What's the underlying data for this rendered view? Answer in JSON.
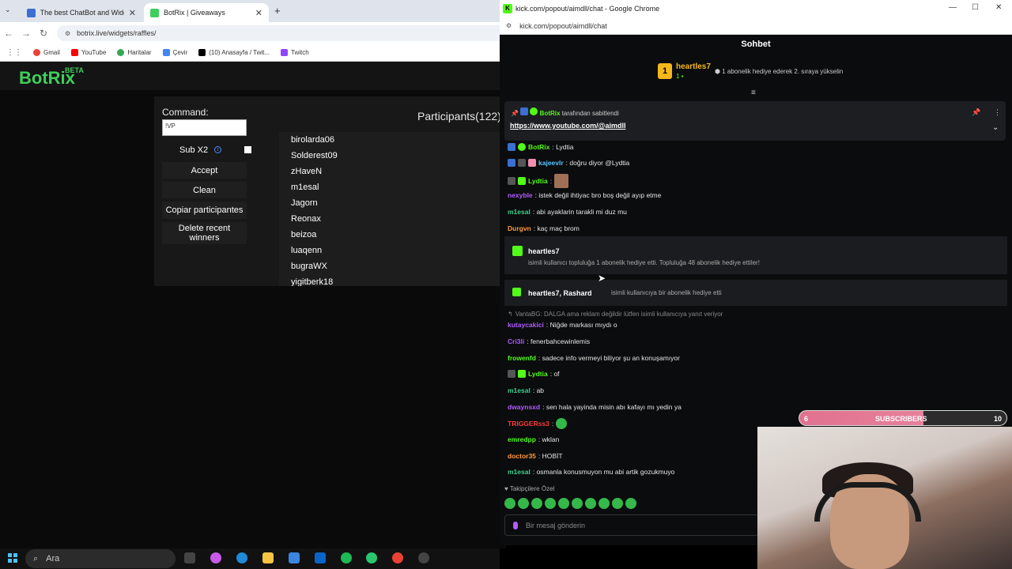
{
  "browser": {
    "tabs": [
      {
        "title": "The best ChatBot and Widgets",
        "color": "#3b6fd1"
      },
      {
        "title": "BotRix | Giveaways",
        "color": "#3fcf5c"
      }
    ],
    "address": "botrix.live/widgets/raffles/",
    "bookmarks": [
      "Gmail",
      "YouTube",
      "Haritalar",
      "Çevir",
      "(10) Anasayfa / Twit...",
      "Twitch"
    ]
  },
  "botrix": {
    "logo": "BotRix",
    "beta": "BETA",
    "command_label": "Command:",
    "command_value": "!VP",
    "sub_label": "Sub X2",
    "info": "i",
    "buttons": {
      "accept": "Accept",
      "clean": "Clean",
      "copy": "Copiar participantes",
      "delete": "Delete recent winners"
    },
    "participants_title": "Participants(122):",
    "participants": [
      "birolarda06",
      "Solderest09",
      "zHaveN",
      "m1esal",
      "Jagorn",
      "Reonax",
      "beizoa",
      "luaqenn",
      "bugraWX",
      "yigitberk18"
    ]
  },
  "taskbar": {
    "search": "Ara"
  },
  "kick": {
    "window_title": "kick.com/popout/aimdll/chat - Google Chrome",
    "address": "kick.com/popout/aimdll/chat",
    "header": "Sohbet",
    "top_gifter": {
      "rank": "1",
      "name": "heartles7",
      "count": "1",
      "note": "1 abonelik hediye ederek 2. sıraya yükselin"
    },
    "pinned": {
      "by": "BotRix",
      "suffix": "tarafından sabitlendi",
      "link": "https://www.youtube.com/@aimdll"
    },
    "messages": [
      {
        "user": "BotRix",
        "color": "#53fc18",
        "text": ": Lydtia"
      },
      {
        "user": "kajeevlr",
        "color": "#56c4ff",
        "text": ": doğru diyor @Lydtia"
      },
      {
        "user": "Lydtia",
        "color": "#53fc18",
        "text": ":"
      },
      {
        "user": "nexyble",
        "color": "#b05cff",
        "text": ": istek değil ihtiyac bro boş değil ayıp etme"
      },
      {
        "user": "m1esal",
        "color": "#3fcf8e",
        "text": ": abi ayaklarin tarakli mi duz mu"
      },
      {
        "user": "Durgvn",
        "color": "#ff9a3c",
        "text": ": kaç maç brom"
      }
    ],
    "gift1": {
      "name": "heartles7",
      "text": "isimli kullanıcı topluluğa 1 abonelik hediye etti. Topluluğa 48 abonelik hediye ettiler!"
    },
    "gift2": {
      "name": "heartles7, Rashard",
      "text": "isimli kullanıcıya bir abonelik hediye etti"
    },
    "reply_note": "VantaBG: DALGA ama reklam değildir lütfen isimli kullanıcıya yanıt veriyor",
    "messages2": [
      {
        "user": "kutaycakici",
        "color": "#b05cff",
        "text": ": Niğde markası mıydı o"
      },
      {
        "user": "Cri3li",
        "color": "#b05cff",
        "text": ": fenerbahcewinlemis"
      },
      {
        "user": "frowenfd",
        "color": "#53fc18",
        "text": ": sadece info vermeyi biliyor şu an konuşamıyor"
      },
      {
        "user": "Lydtia",
        "color": "#53fc18",
        "text": ": of"
      },
      {
        "user": "m1esal",
        "color": "#3fcf8e",
        "text": ": ab"
      },
      {
        "user": "dwaynsxd",
        "color": "#b05cff",
        "text": ": sen hala yayinda misin abı kafayı mı yedin ya"
      },
      {
        "user": "TRIGGERss3",
        "color": "#ff3b3b",
        "text": ":"
      },
      {
        "user": "emredpp",
        "color": "#53fc18",
        "text": ": wklan"
      },
      {
        "user": "doctor35",
        "color": "#ff9a3c",
        "text": ": HOBİT"
      },
      {
        "user": "m1esal",
        "color": "#3fcf8e",
        "text": ": osmanla konusmuyon mu abi artik gozukmuyo"
      }
    ],
    "followers_only": "Takipçilere Özel",
    "input_placeholder": "Bir mesaj gönderin"
  },
  "overlay": {
    "subs_left": "6",
    "subs_label": "SUBSCRIBERS",
    "subs_right": "10",
    "progress": 0.6
  }
}
